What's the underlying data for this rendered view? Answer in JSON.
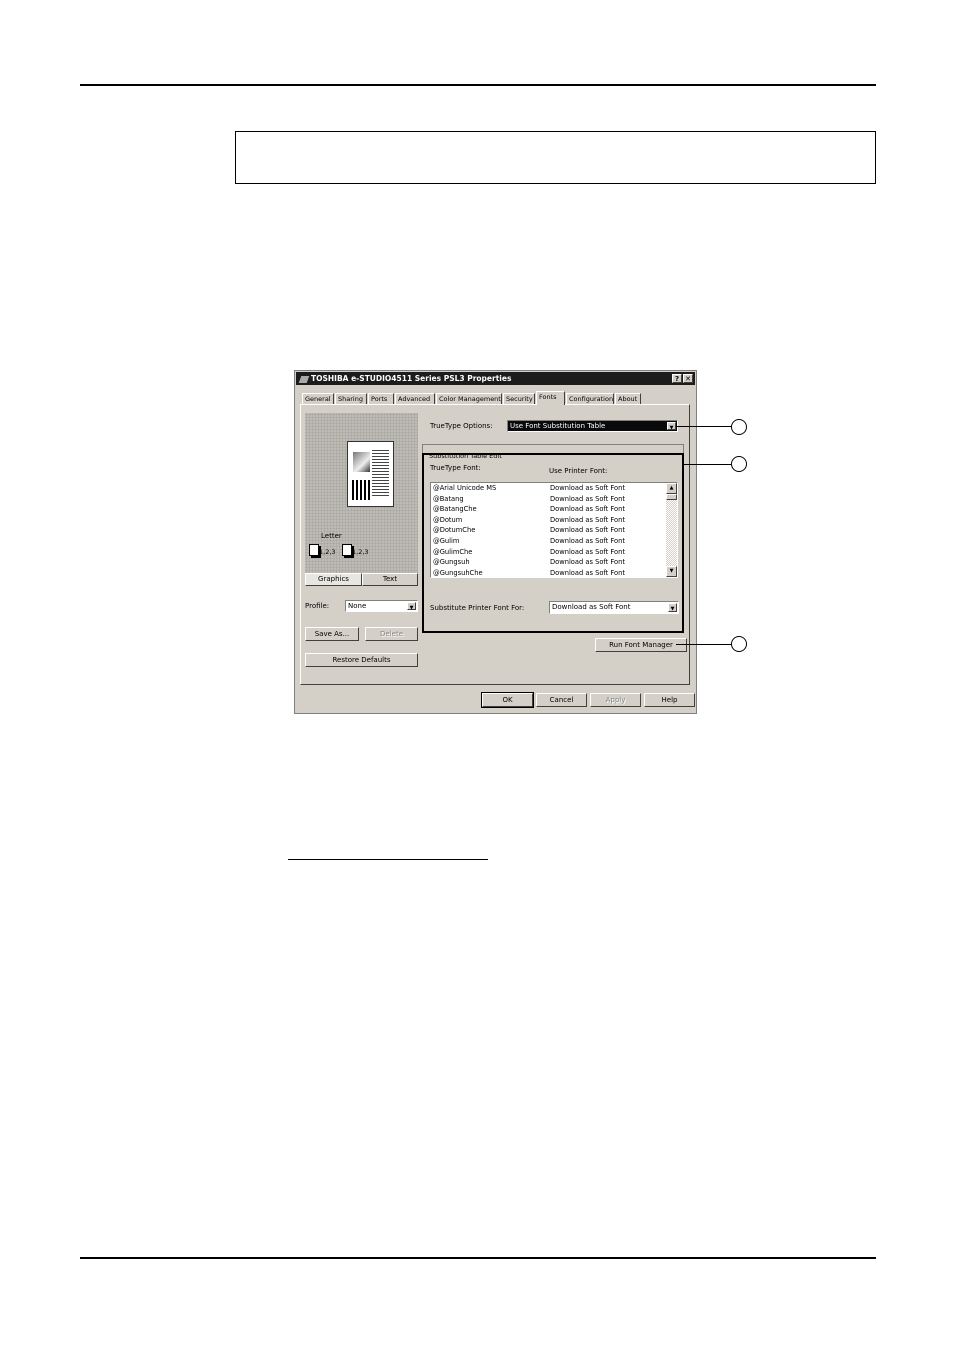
{
  "dialog": {
    "title": "TOSHIBA e-STUDIO4511 Series PSL3 Properties",
    "help_btn": "?",
    "close_btn": "✕",
    "tabs": [
      "General",
      "Sharing",
      "Ports",
      "Advanced",
      "Color Management",
      "Security",
      "Fonts",
      "Configuration",
      "About"
    ],
    "active_tab": "Fonts",
    "preview": {
      "paper_size": "Letter",
      "copies_a": "1,2,3",
      "copies_b": "1,2,3",
      "graphics_tab": "Graphics",
      "text_tab": "Text"
    },
    "profile_label": "Profile:",
    "profile_value": "None",
    "save_as": "Save As...",
    "delete": "Delete",
    "restore_defaults": "Restore Defaults",
    "truetype_options_label": "TrueType Options:",
    "truetype_options_value": "Use Font Substitution Table",
    "group_title": "Substitution Table Edit",
    "col_truetype": "TrueType Font:",
    "col_printer": "Use Printer Font:",
    "font_rows": [
      {
        "font": "@Arial Unicode MS",
        "printer": "Download as Soft Font"
      },
      {
        "font": "@Batang",
        "printer": "Download as Soft Font"
      },
      {
        "font": "@BatangChe",
        "printer": "Download as Soft Font"
      },
      {
        "font": "@Dotum",
        "printer": "Download as Soft Font"
      },
      {
        "font": "@DotumChe",
        "printer": "Download as Soft Font"
      },
      {
        "font": "@Gulim",
        "printer": "Download as Soft Font"
      },
      {
        "font": "@GulimChe",
        "printer": "Download as Soft Font"
      },
      {
        "font": "@Gungsuh",
        "printer": "Download as Soft Font"
      },
      {
        "font": "@GungsuhChe",
        "printer": "Download as Soft Font"
      }
    ],
    "substitute_label": "Substitute Printer Font For:",
    "substitute_value": "Download as Soft Font",
    "run_font_manager": "Run Font Manager",
    "ok": "OK",
    "cancel": "Cancel",
    "apply": "Apply",
    "help": "Help"
  },
  "icons": {
    "titlebar": "printer-icon",
    "dropdown": "chevron-down-icon",
    "scroll_up": "triangle-up-icon",
    "scroll_down": "triangle-down-icon"
  }
}
